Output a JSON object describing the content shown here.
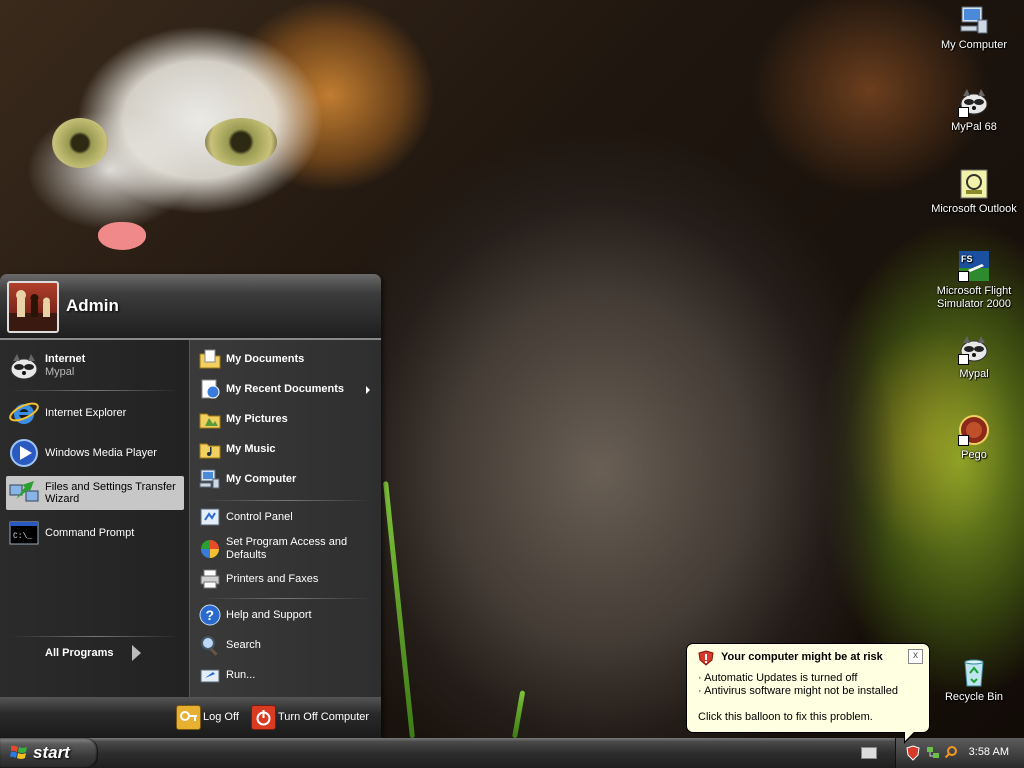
{
  "desktop": {
    "icons": [
      {
        "label": "My Computer"
      },
      {
        "label": "MyPal 68"
      },
      {
        "label": "Microsoft Outlook"
      },
      {
        "label": "Microsoft Flight Simulator 2000"
      },
      {
        "label": "Mypal"
      },
      {
        "label": "Pego"
      },
      {
        "label": "Recycle Bin"
      }
    ]
  },
  "start_menu": {
    "user": "Admin",
    "pinned": {
      "title": "Internet",
      "subtitle": "Mypal"
    },
    "left_items": [
      {
        "label": "Internet Explorer"
      },
      {
        "label": "Windows Media Player"
      },
      {
        "label": "Files and Settings Transfer Wizard"
      },
      {
        "label": "Command Prompt"
      }
    ],
    "all_programs": "All Programs",
    "right_items": [
      {
        "label": "My Documents"
      },
      {
        "label": "My Recent Documents"
      },
      {
        "label": "My Pictures"
      },
      {
        "label": "My Music"
      },
      {
        "label": "My Computer"
      },
      {
        "label": "Control Panel"
      },
      {
        "label": "Set Program Access and Defaults"
      },
      {
        "label": "Printers and Faxes"
      },
      {
        "label": "Help and Support"
      },
      {
        "label": "Search"
      },
      {
        "label": "Run..."
      }
    ],
    "log_off": "Log Off",
    "turn_off": "Turn Off Computer"
  },
  "taskbar": {
    "start_label": "start",
    "clock": "3:58 AM"
  },
  "balloon": {
    "title": "Your computer might be at risk",
    "line1": "Automatic Updates is turned off",
    "line2": "Antivirus software might not be installed",
    "footer": "Click this balloon to fix this problem.",
    "close": "x"
  },
  "colors": {
    "menu_dark": "#1b1b1b",
    "balloon_bg": "#ffffe1",
    "hover_bg": "#c7c7c7"
  }
}
